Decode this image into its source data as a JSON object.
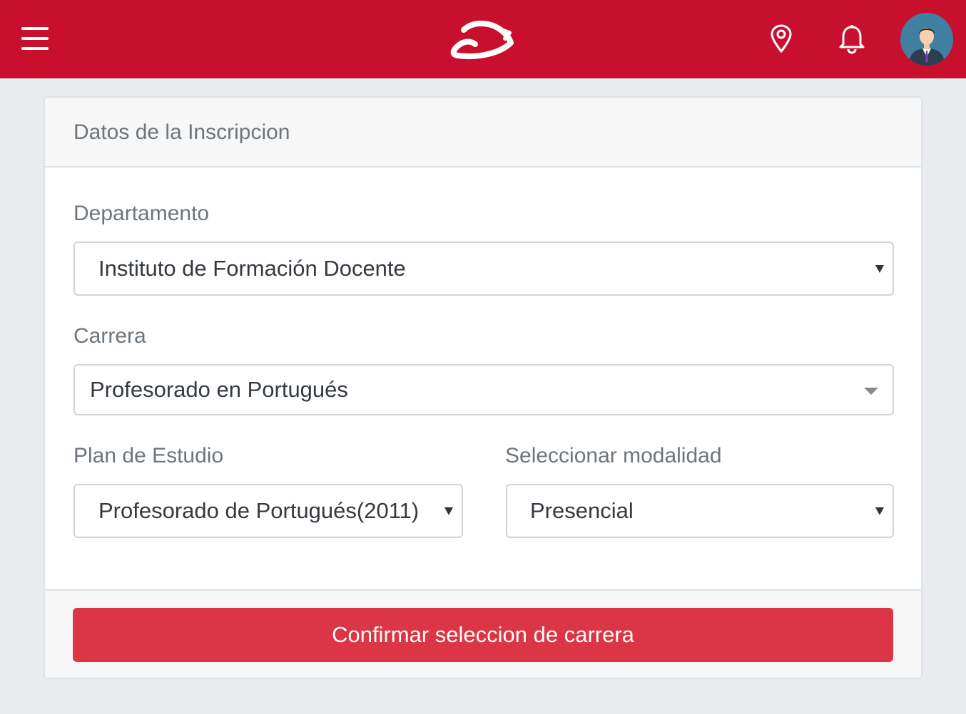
{
  "header": {
    "menu_icon": "hamburger-menu-icon",
    "logo_icon": "brand-logo-icon",
    "location_icon": "map-pin-icon",
    "notification_icon": "bell-icon",
    "avatar_icon": "user-avatar-icon",
    "brand_color": "#c8102e"
  },
  "form": {
    "title": "Datos de la Inscripcion",
    "departamento": {
      "label": "Departamento",
      "selected": "Instituto de Formación Docente"
    },
    "carrera": {
      "label": "Carrera",
      "selected": "Profesorado en Portugués"
    },
    "plan": {
      "label": "Plan de Estudio",
      "selected": "Profesorado de Portugués(2011)"
    },
    "modalidad": {
      "label": "Seleccionar modalidad",
      "selected": "Presencial"
    },
    "confirm_label": "Confirmar seleccion de carrera",
    "confirm_color": "#dc3545"
  }
}
